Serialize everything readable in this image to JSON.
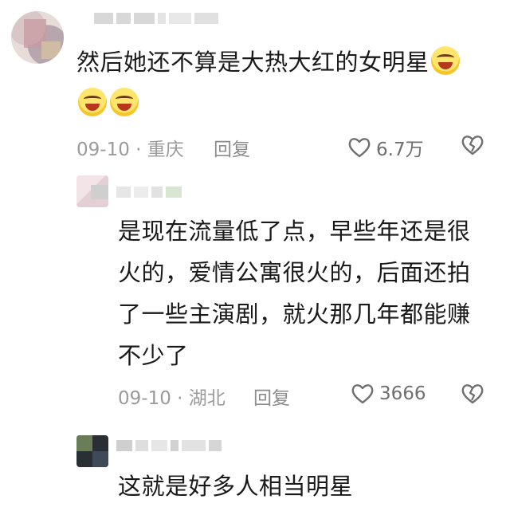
{
  "comments": [
    {
      "text": "然后她还不算是大热大红的女明星",
      "emoji_names": [
        "laughing-tears-emoji",
        "laughing-tears-emoji",
        "laughing-tears-emoji"
      ],
      "date": "09-10",
      "location": "重庆",
      "reply_label": "回复",
      "likes": "6.7万"
    },
    {
      "text": "是现在流量低了点，早些年还是很火的，爱情公寓很火的，后面还拍了一些主演剧，就火那几年都能赚不少了",
      "date": "09-10",
      "location": "湖北",
      "reply_label": "回复",
      "likes": "3666"
    },
    {
      "text": "这就是好多人相当明星"
    }
  ],
  "separator": " · ",
  "icons": {
    "like": "heart-outline-icon",
    "dislike": "broken-heart-outline-icon"
  },
  "colors": {
    "text": "#1a1a1a",
    "meta": "#9a9a9a",
    "emoji": "#ffd93d"
  }
}
